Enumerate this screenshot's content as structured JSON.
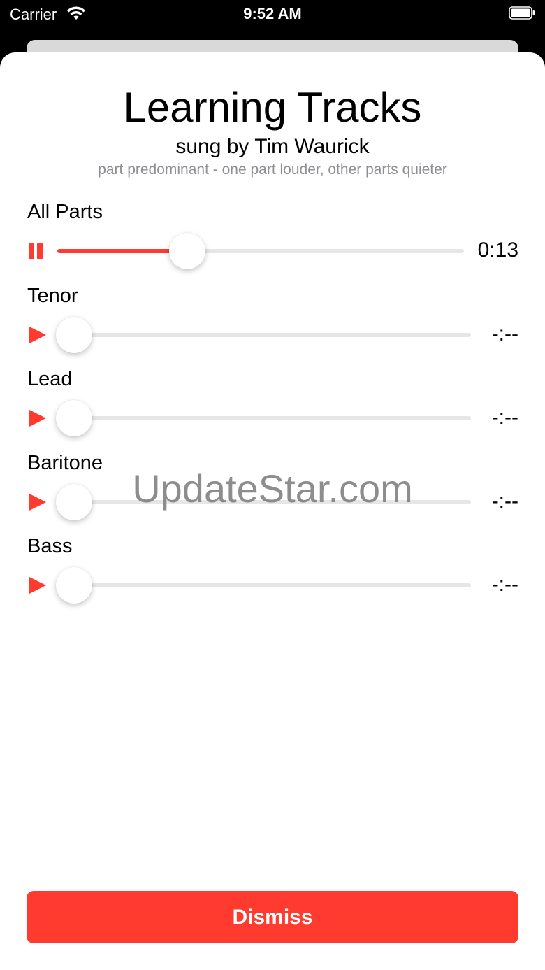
{
  "status_bar": {
    "carrier": "Carrier",
    "time": "9:52 AM",
    "wifi_icon": "wifi-icon",
    "battery_icon": "battery-icon"
  },
  "header": {
    "title": "Learning Tracks",
    "subtitle": "sung by Tim Waurick",
    "note": "part predominant - one part louder, other parts quieter"
  },
  "tracks": [
    {
      "label": "All Parts",
      "time": "0:13",
      "state": "playing",
      "progress": 0.32,
      "icon": "pause-icon"
    },
    {
      "label": "Tenor",
      "time": "-:--",
      "state": "stopped",
      "progress": 0,
      "icon": "play-icon"
    },
    {
      "label": "Lead",
      "time": "-:--",
      "state": "stopped",
      "progress": 0,
      "icon": "play-icon"
    },
    {
      "label": "Baritone",
      "time": "-:--",
      "state": "stopped",
      "progress": 0,
      "icon": "play-icon"
    },
    {
      "label": "Bass",
      "time": "-:--",
      "state": "stopped",
      "progress": 0,
      "icon": "play-icon"
    }
  ],
  "watermark": "UpdateStar.com",
  "dismiss_label": "Dismiss",
  "colors": {
    "accent": "#ff3b30",
    "track": "#e6e6e6",
    "secondary_text": "#8e8e93"
  }
}
